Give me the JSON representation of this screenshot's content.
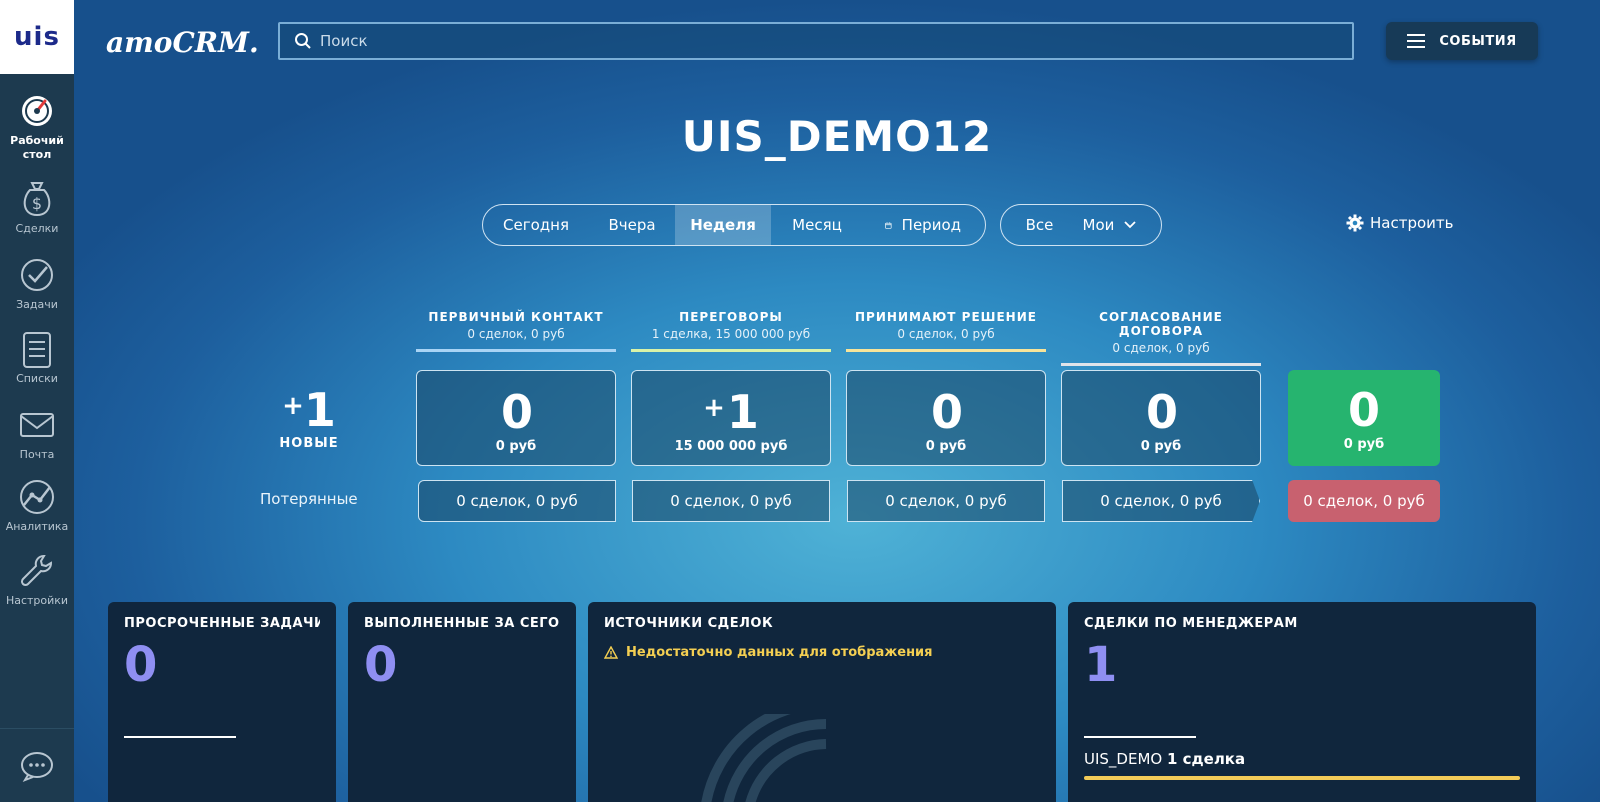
{
  "sidebar": {
    "logo": "uis",
    "items": [
      {
        "label": "Рабочий стол",
        "icon": "dashboard-icon",
        "active": true
      },
      {
        "label": "Сделки",
        "icon": "money-bag-icon"
      },
      {
        "label": "Задачи",
        "icon": "check-circle-icon"
      },
      {
        "label": "Списки",
        "icon": "list-icon"
      },
      {
        "label": "Почта",
        "icon": "mail-icon"
      },
      {
        "label": "Аналитика",
        "icon": "analytics-icon"
      },
      {
        "label": "Настройки",
        "icon": "wrench-icon"
      }
    ],
    "chat_icon": "chat-icon"
  },
  "header": {
    "brand": "amoCRM.",
    "search_placeholder": "Поиск",
    "events_label": "СОБЫТИЯ"
  },
  "page_title": "UIS_DEMO12",
  "filters": {
    "periods": [
      "Сегодня",
      "Вчера",
      "Неделя",
      "Месяц",
      "Период"
    ],
    "active_period": "Неделя",
    "owner_all": "Все",
    "owner_mine": "Мои",
    "configure": "Настроить"
  },
  "pipeline": {
    "new": {
      "prefix": "+",
      "value": "1",
      "label": "НОВЫЕ"
    },
    "lost_label": "Потерянные",
    "stages": [
      {
        "name": "ПЕРВИЧНЫЙ КОНТАКТ",
        "summary": "0 сделок, 0 руб",
        "prefix": "",
        "value": "0",
        "money": "0 руб",
        "lost": "0 сделок, 0 руб",
        "color": "#a9d4f5"
      },
      {
        "name": "ПЕРЕГОВОРЫ",
        "summary": "1 сделка, 15 000 000 руб",
        "prefix": "+",
        "value": "1",
        "money": "15 000 000 руб",
        "lost": "0 сделок, 0 руб",
        "color": "#d9f2a8"
      },
      {
        "name": "ПРИНИМАЮТ РЕШЕНИЕ",
        "summary": "0 сделок, 0 руб",
        "prefix": "",
        "value": "0",
        "money": "0 руб",
        "lost": "0 сделок, 0 руб",
        "color": "#f7e49a"
      },
      {
        "name": "СОГЛАСОВАНИЕ ДОГОВОРА",
        "summary": "0 сделок, 0 руб",
        "prefix": "",
        "value": "0",
        "money": "0 руб",
        "lost": "0 сделок, 0 руб",
        "color": "#dfe4ea"
      }
    ],
    "won": {
      "value": "0",
      "money": "0 руб",
      "color": "#26b46f"
    },
    "lost_final": {
      "text": "0 сделок, 0 руб",
      "color": "#c8616f"
    }
  },
  "widgets": {
    "overdue": {
      "title": "ПРОСРОЧЕННЫЕ ЗАДАЧИ",
      "value": "0"
    },
    "done_today": {
      "title": "ВЫПОЛНЕННЫЕ ЗА СЕГОДНЯ",
      "value": "0"
    },
    "sources": {
      "title": "ИСТОЧНИКИ СДЕЛОК",
      "warning": "Недостаточно данных для отображения"
    },
    "managers": {
      "title": "СДЕЛКИ ПО МЕНЕДЖЕРАМ",
      "value": "1",
      "manager": "UIS_DEMO",
      "deals": "1 сделка"
    }
  }
}
